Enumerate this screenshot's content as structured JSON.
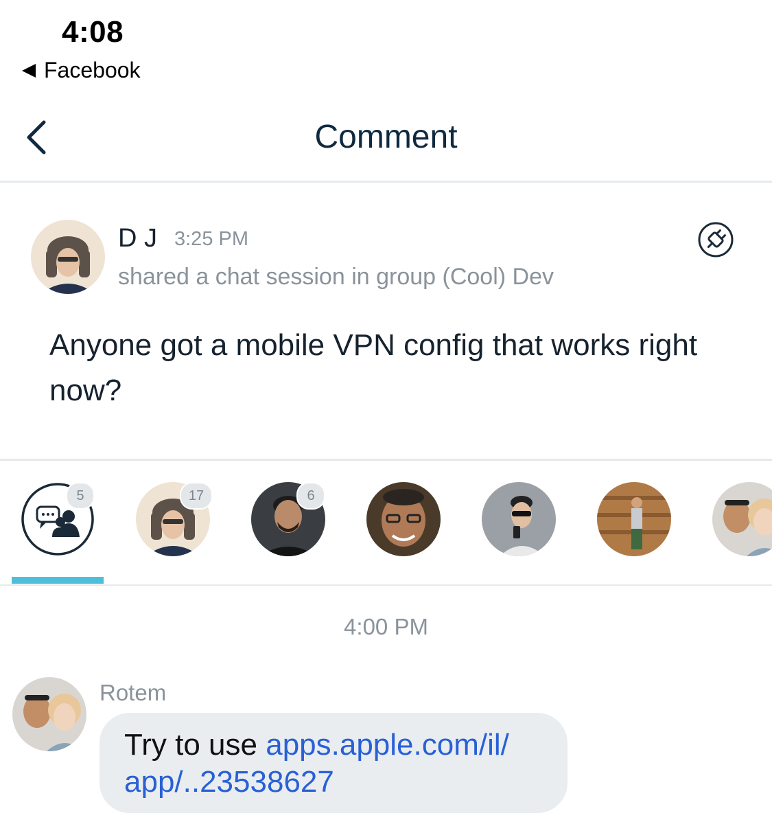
{
  "status_bar": {
    "time": "4:08",
    "back_app": "Facebook"
  },
  "header": {
    "title": "Comment"
  },
  "post": {
    "author": "D J",
    "time": "3:25 PM",
    "subtitle": "shared a chat session in group (Cool) Dev",
    "body": "Anyone got a mobile VPN config that works right now?"
  },
  "participants": {
    "group_count": "5",
    "members": [
      {
        "count": "17"
      },
      {
        "count": "6"
      },
      {
        "count": ""
      },
      {
        "count": ""
      },
      {
        "count": ""
      },
      {
        "count": ""
      }
    ]
  },
  "thread": {
    "time_separator": "4:00 PM",
    "messages": [
      {
        "sender": "Rotem",
        "text": "Try to use ",
        "link": "apps.apple.com/il/\napp/..23538627"
      }
    ]
  },
  "colors": {
    "accent": "#4dbfdb",
    "link": "#2960d6",
    "bubble": "#e9edf0",
    "title": "#0f2a40"
  }
}
